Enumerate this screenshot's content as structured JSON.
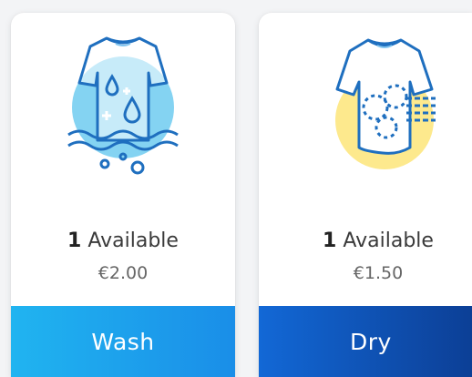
{
  "cards": [
    {
      "icon": "washing-shirt-icon",
      "available_count": "1",
      "available_label": "Available",
      "price": "€2.00",
      "action_label": "Wash",
      "accent_color": "#1a9fef"
    },
    {
      "icon": "drying-shirt-icon",
      "available_count": "1",
      "available_label": "Available",
      "price": "€1.50",
      "action_label": "Dry",
      "accent_color": "#0d4ea9"
    }
  ],
  "colors": {
    "wash_circle": "#84d3f2",
    "dry_circle": "#fde98d",
    "outline": "#1f6fbf"
  }
}
